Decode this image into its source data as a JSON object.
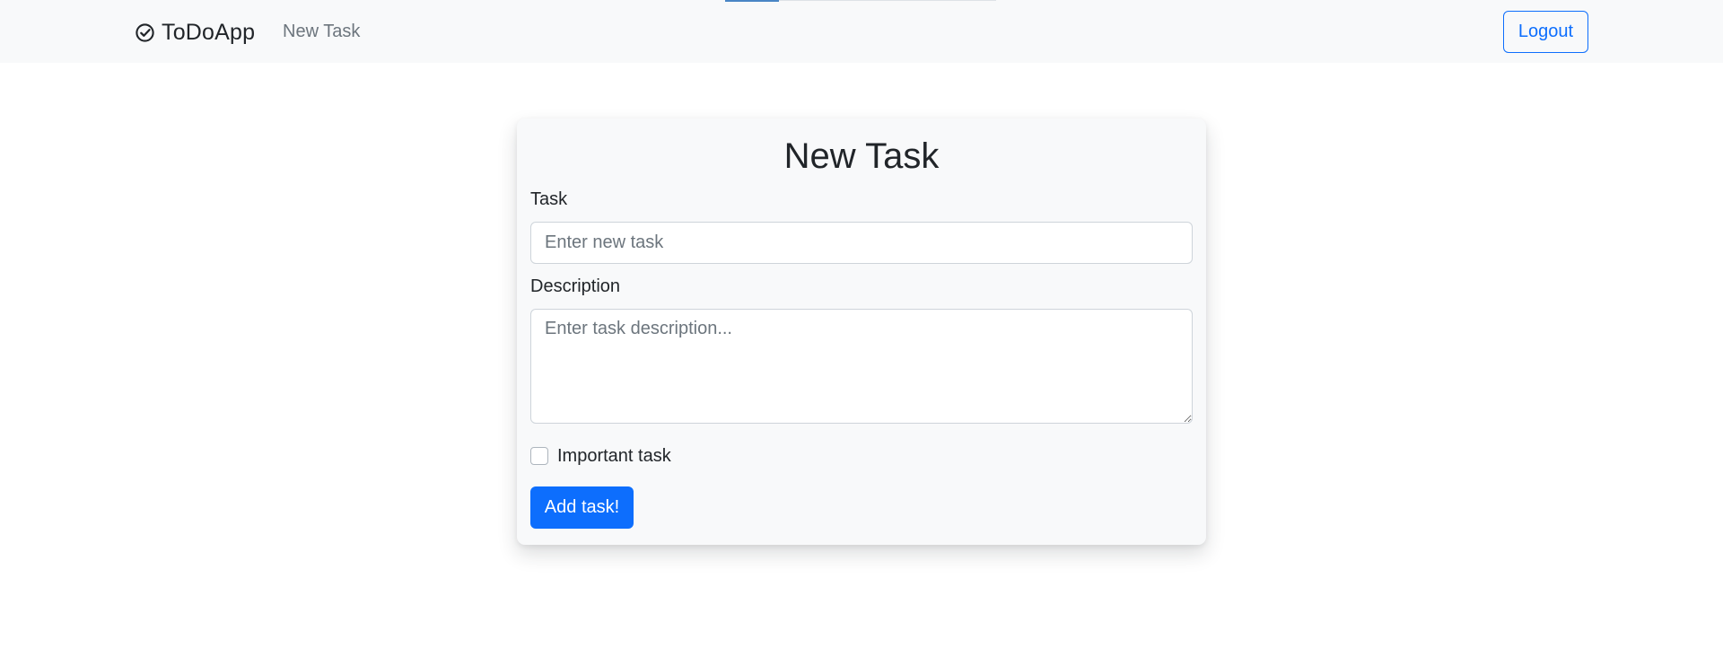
{
  "navbar": {
    "brand": "ToDoApp",
    "brand_icon": "check-circle-icon",
    "new_task_link": "New Task",
    "logout_label": "Logout",
    "page_load_progress": 0.2
  },
  "form": {
    "title": "New Task",
    "task_label": "Task",
    "task_value": "",
    "task_placeholder": "Enter new task",
    "description_label": "Description",
    "description_value": "",
    "description_placeholder": "Enter task description...",
    "important_label": "Important task",
    "important_checked": false,
    "submit_label": "Add task!"
  },
  "colors": {
    "primary": "#0d6efd",
    "navbar_bg": "#f8f9fa",
    "card_bg": "#f8f9fa",
    "muted_text": "#6c757d"
  }
}
